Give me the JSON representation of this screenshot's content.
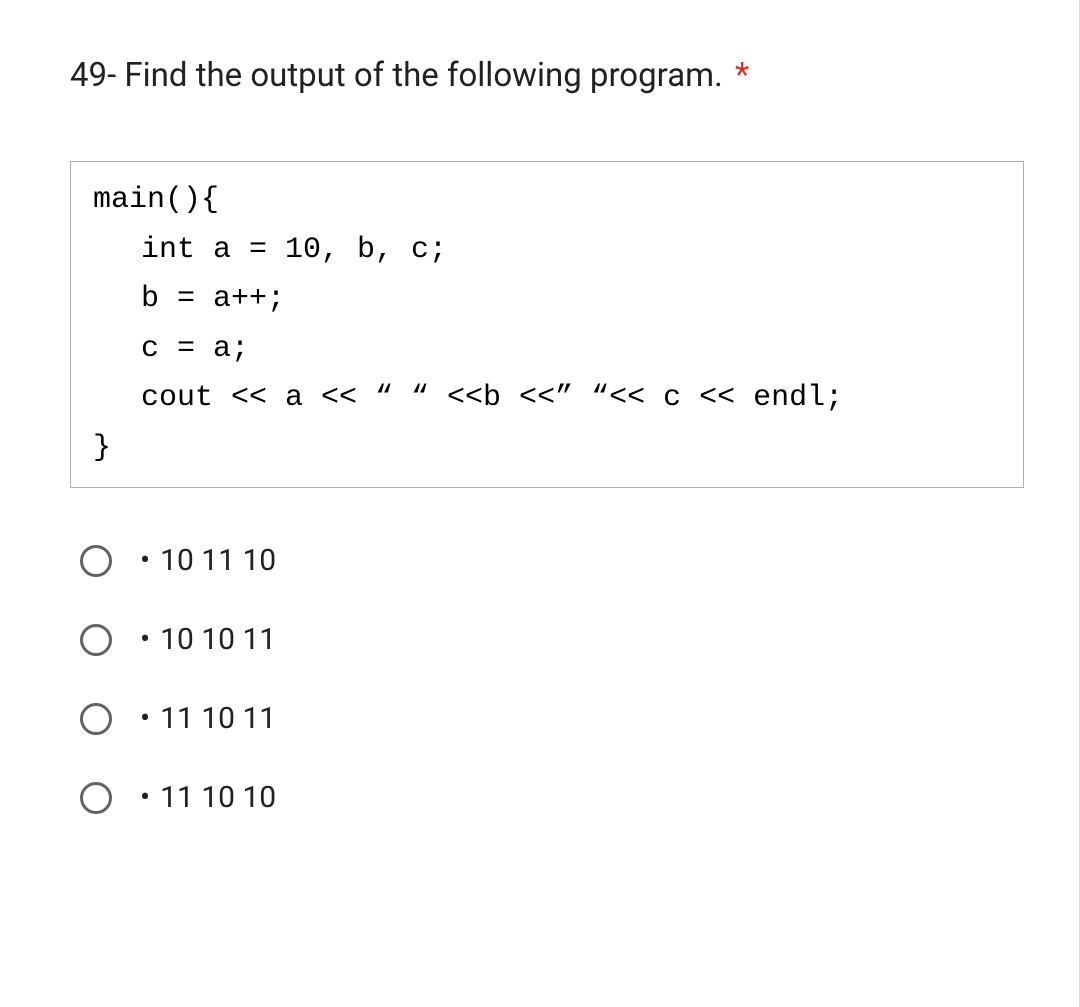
{
  "question": {
    "number": "49-",
    "text": "Find the output of the following program.",
    "required_marker": "*"
  },
  "code": {
    "line1": "main(){",
    "line2": "int a = 10, b, c;",
    "line3": "b   = a++;",
    "line4": "c = a;",
    "line5": "cout << a << “ “ <<b <<” “<< c << endl;",
    "line6": "}"
  },
  "options": [
    {
      "label": "10 11 10"
    },
    {
      "label": "10 10 11"
    },
    {
      "label": "11 10 11"
    },
    {
      "label": "11 10 10"
    }
  ]
}
